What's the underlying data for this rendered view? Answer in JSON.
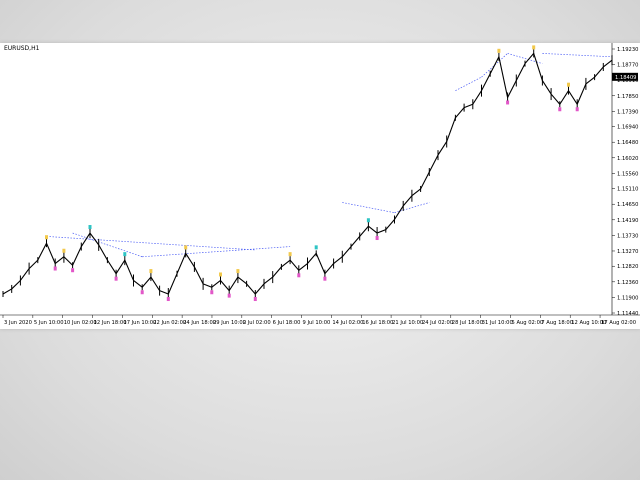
{
  "chart_data": {
    "type": "line",
    "title": "EURUSD,H1",
    "x_labels": [
      "3 Jun 2020",
      "5 Jun 10:00",
      "10 Jun 02:00",
      "12 Jun 18:00",
      "17 Jun 10:00",
      "22 Jun 02:00",
      "24 Jun 18:00",
      "29 Jun 10:00",
      "2 Jul 02:00",
      "6 Jul 18:00",
      "9 Jul 10:00",
      "14 Jul 02:00",
      "16 Jul 18:00",
      "21 Jul 10:00",
      "24 Jul 02:00",
      "28 Jul 18:00",
      "31 Jul 10:00",
      "5 Aug 02:00",
      "7 Aug 18:00",
      "12 Aug 10:00",
      "17 Aug 02:00"
    ],
    "y_labels": [
      "1.19230",
      "1.18770",
      "1.18310",
      "1.17850",
      "1.17390",
      "1.16940",
      "1.16480",
      "1.16020",
      "1.15560",
      "1.15110",
      "1.14650",
      "1.14190",
      "1.13730",
      "1.13270",
      "1.12820",
      "1.12360",
      "1.11900",
      "1.11440"
    ],
    "ylim": [
      1.1144,
      1.1923
    ],
    "current_price": "1.18409",
    "series": [
      {
        "values": [
          1.12,
          1.1215,
          1.124,
          1.1275,
          1.13,
          1.135,
          1.129,
          1.131,
          1.1285,
          1.134,
          1.138,
          1.1345,
          1.13,
          1.126,
          1.13,
          1.124,
          1.122,
          1.125,
          1.121,
          1.12,
          1.126,
          1.132,
          1.128,
          1.123,
          1.122,
          1.124,
          1.121,
          1.125,
          1.123,
          1.12,
          1.123,
          1.125,
          1.128,
          1.13,
          1.127,
          1.129,
          1.132,
          1.126,
          1.129,
          1.131,
          1.134,
          1.137,
          1.14,
          1.138,
          1.139,
          1.142,
          1.146,
          1.149,
          1.151,
          1.156,
          1.161,
          1.165,
          1.172,
          1.175,
          1.176,
          1.18,
          1.185,
          1.19,
          1.178,
          1.183,
          1.188,
          1.191,
          1.183,
          1.179,
          1.176,
          1.18,
          1.176,
          1.182,
          1.184,
          1.187,
          1.189
        ]
      }
    ],
    "trend_lines": [
      {
        "from": [
          5,
          1.137
        ],
        "to": [
          29,
          1.133
        ]
      },
      {
        "from": [
          8,
          1.138
        ],
        "to": [
          16,
          1.131
        ]
      },
      {
        "from": [
          16,
          1.131
        ],
        "to": [
          33,
          1.134
        ]
      },
      {
        "from": [
          39,
          1.147
        ],
        "to": [
          45,
          1.144
        ]
      },
      {
        "from": [
          45,
          1.144
        ],
        "to": [
          49,
          1.147
        ]
      },
      {
        "from": [
          52,
          1.18
        ],
        "to": [
          55,
          1.184
        ]
      },
      {
        "from": [
          55,
          1.184
        ],
        "to": [
          58,
          1.191
        ]
      },
      {
        "from": [
          58,
          1.191
        ],
        "to": [
          62,
          1.188
        ]
      },
      {
        "from": [
          62,
          1.191
        ],
        "to": [
          70,
          1.19
        ]
      }
    ],
    "line_color": "#000000",
    "trend_color": "#4a5cf5",
    "marker_colors": [
      "#2ec4c4",
      "#f2c94c",
      "#e256c8"
    ]
  }
}
